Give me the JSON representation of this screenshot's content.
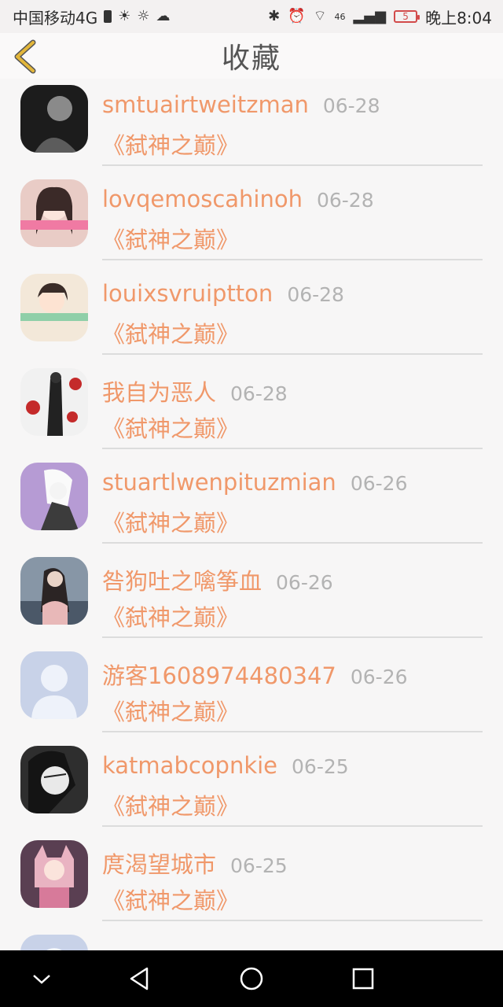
{
  "status_bar": {
    "carrier": "中国移动4G",
    "network": "46",
    "battery": "5",
    "time": "晚上8:04"
  },
  "header": {
    "title": "收藏"
  },
  "items": [
    {
      "name": "smtuairtweitzman",
      "date": "06-28",
      "book": "《弑神之巅》",
      "avatar_color": "#2b2b2b"
    },
    {
      "name": "lovqemoscahinoh",
      "date": "06-28",
      "book": "《弑神之巅》",
      "avatar_color": "#e7c8c4"
    },
    {
      "name": "louixsvruiptton",
      "date": "06-28",
      "book": "《弑神之巅》",
      "avatar_color": "#f1e6d7"
    },
    {
      "name": "我自为恶人",
      "date": "06-28",
      "book": "《弑神之巅》",
      "avatar_color": "#f2f2f2"
    },
    {
      "name": "stuartlwenpituzmian",
      "date": "06-26",
      "book": "《弑神之巅》",
      "avatar_color": "#b59ad3"
    },
    {
      "name": "咎狗吐之噙筝血",
      "date": "06-26",
      "book": "《弑神之巅》",
      "avatar_color": "#6f7f90"
    },
    {
      "name": "游客1608974480347",
      "date": "06-26",
      "book": "《弑神之巅》",
      "avatar_color": "#c9d3e8"
    },
    {
      "name": "katmabcopnkie",
      "date": "06-25",
      "book": "《弑神之巅》",
      "avatar_color": "#3a3a3a"
    },
    {
      "name": "庹渴望城市",
      "date": "06-25",
      "book": "《弑神之巅》",
      "avatar_color": "#7e5a6b"
    }
  ],
  "colors": {
    "accent": "#f0986a",
    "date": "#b3b3b3",
    "back_arrow": "#e2b63a"
  }
}
